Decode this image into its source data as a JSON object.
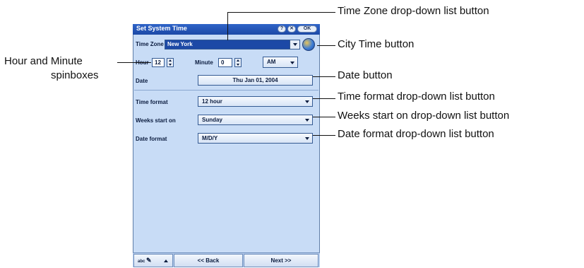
{
  "window": {
    "title": "Set System Time",
    "help_label": "?",
    "close_label": "✕",
    "ok_label": "OK"
  },
  "time_zone": {
    "label": "Time Zone",
    "value": "New York"
  },
  "hour": {
    "label": "Hour",
    "value": "12"
  },
  "minute": {
    "label": "Minute",
    "value": "0"
  },
  "ampm": {
    "value": "AM"
  },
  "date": {
    "label": "Date",
    "value": "Thu Jan 01, 2004"
  },
  "time_format": {
    "label": "Time format",
    "value": "12 hour"
  },
  "weeks_start": {
    "label": "Weeks start on",
    "value": "Sunday"
  },
  "date_format": {
    "label": "Date format",
    "value": "M/D/Y"
  },
  "bottom_bar": {
    "input_label": "abc",
    "back_label": "<< Back",
    "next_label": "Next >>"
  },
  "callouts": {
    "time_zone": "Time Zone drop-down list button",
    "city_time": "City Time button",
    "hour_minute_line1": "Hour and Minute",
    "hour_minute_line2": "spinboxes",
    "date": "Date button",
    "time_format": "Time format drop-down list button",
    "weeks_start": "Weeks start on drop-down list button",
    "date_format": "Date format drop-down list button"
  },
  "colors": {
    "window_bg": "#c8dcf6",
    "title_bar": "#1c49a6",
    "selected_field": "#1c49a6"
  }
}
